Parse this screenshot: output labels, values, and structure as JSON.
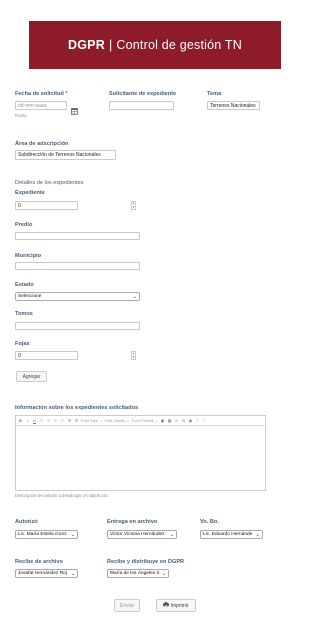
{
  "header": {
    "brand": "DGPR",
    "separator": "|",
    "title": "Control de gestión TN"
  },
  "fecha": {
    "label": "Fecha de solicitud",
    "required_mark": "*",
    "placeholder": "dd-mm-aaaa",
    "sublabel": "Fecha"
  },
  "solicitante": {
    "label": "Solicitante de expediente",
    "value": ""
  },
  "tema": {
    "label": "Tema",
    "value": "Terrenos Nacionales"
  },
  "area": {
    "label": "Área de adscripción",
    "value": "Subdirección de Terrenos Nacionales"
  },
  "detalles": {
    "section_title": "Detalles de los expedientes",
    "expediente": {
      "label": "Expediente",
      "value": "0"
    },
    "predio": {
      "label": "Predio",
      "value": ""
    },
    "municipio": {
      "label": "Municipio",
      "value": ""
    },
    "estado": {
      "label": "Estado",
      "selected": "Seleccione"
    },
    "tomos": {
      "label": "Tomos",
      "value": ""
    },
    "fojas": {
      "label": "Fojas",
      "value": "0"
    },
    "add_button": "Agregar"
  },
  "info": {
    "label": "Información sobre los expedientes solicitados",
    "toolbar": {
      "font_size": "Font Size",
      "font_family": "Font Family",
      "font_format": "Font Format"
    },
    "helper": "Descripción del asunto a desahogar y/o datos uso"
  },
  "firmas": {
    "autorizo": {
      "label": "Autorizó",
      "selected": "Lic. María Estela Gonz"
    },
    "entrega": {
      "label": "Entrega en archivo",
      "selected": "Víctor Victoria Hernández"
    },
    "vobo": {
      "label": "Vo. Bo.",
      "selected": "Lic. Eduardo Hernánde"
    },
    "recibe": {
      "label": "Recibe de archivo",
      "selected": "Josafat Hernández Roj"
    },
    "distribuye": {
      "label": "Recibe y distribuye en DGPR",
      "selected": "María de los Ángeles S"
    }
  },
  "actions": {
    "submit": "Enviar",
    "print": "Imprimir"
  }
}
